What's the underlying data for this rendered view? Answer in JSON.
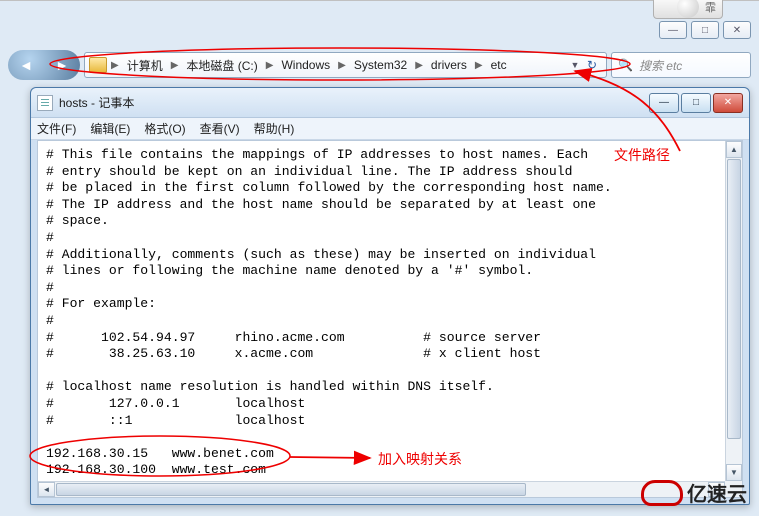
{
  "explorer": {
    "win_controls": {
      "min": "—",
      "max": "□",
      "close": "✕"
    },
    "nav_back": "◄",
    "nav_fwd": "►",
    "breadcrumbs": [
      "计算机",
      "本地磁盘 (C:)",
      "Windows",
      "System32",
      "drivers",
      "etc"
    ],
    "search_placeholder": "搜索 etc"
  },
  "notepad": {
    "title": "hosts - 记事本",
    "controls": {
      "min": "—",
      "max": "□",
      "close": "✕"
    },
    "menu": {
      "file": "文件(F)",
      "edit": "编辑(E)",
      "format": "格式(O)",
      "view": "查看(V)",
      "help": "帮助(H)"
    },
    "content": "# This file contains the mappings of IP addresses to host names. Each\n# entry should be kept on an individual line. The IP address should\n# be placed in the first column followed by the corresponding host name.\n# The IP address and the host name should be separated by at least one\n# space.\n#\n# Additionally, comments (such as these) may be inserted on individual\n# lines or following the machine name denoted by a '#' symbol.\n#\n# For example:\n#\n#      102.54.94.97     rhino.acme.com          # source server\n#       38.25.63.10     x.acme.com              # x client host\n\n# localhost name resolution is handled within DNS itself.\n#       127.0.0.1       localhost\n#       ::1             localhost\n\n192.168.30.15   www.benet.com\n192.168.30.100  www.test.com"
  },
  "annotations": {
    "path_label": "文件路径",
    "mapping_label": "加入映射关系"
  },
  "logo_text": "亿速云"
}
